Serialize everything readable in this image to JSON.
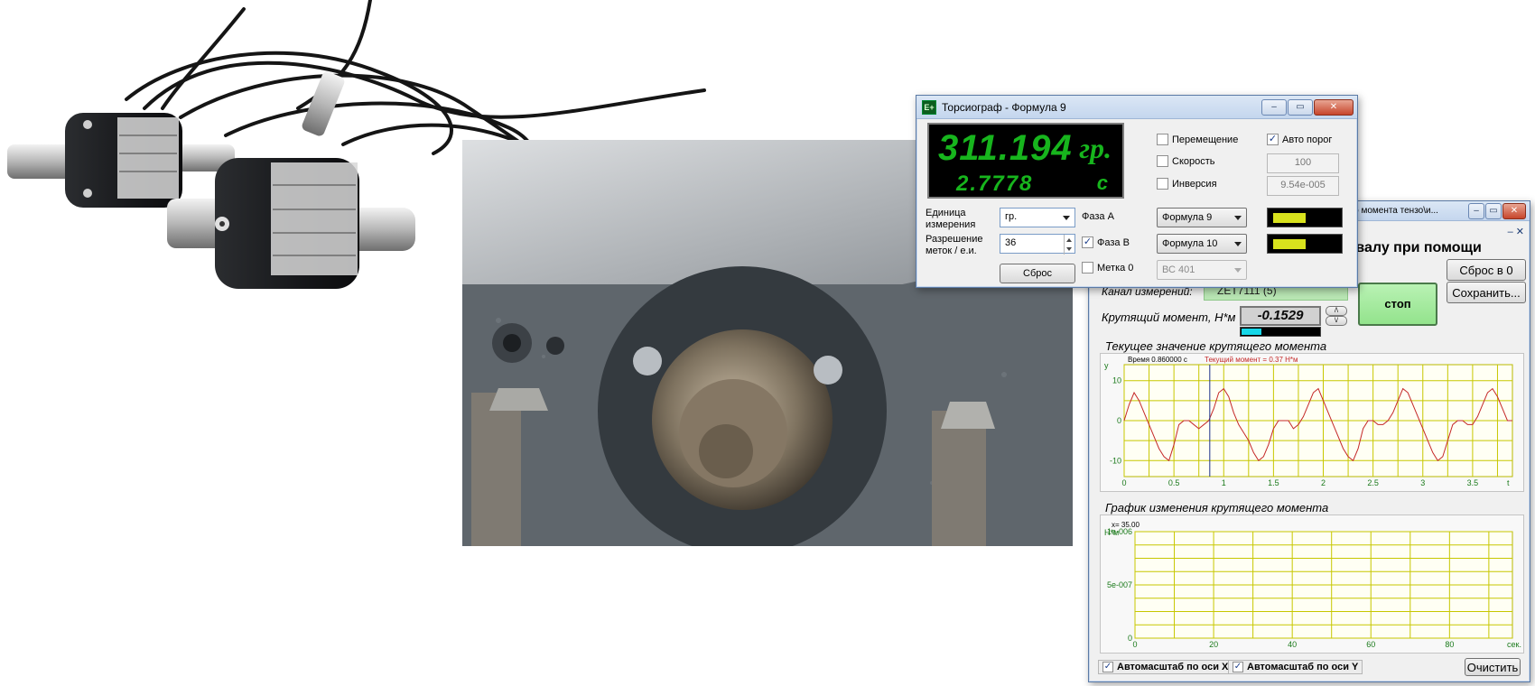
{
  "torsiograph": {
    "title": "Торсиограф - Формула 9",
    "icon_text": "E+",
    "display": {
      "primary_value": "311.194",
      "primary_unit": "гр.",
      "secondary_value": "2.7778",
      "secondary_unit": "с"
    },
    "unit_label": "Единица измерения",
    "unit_value": "гр.",
    "resolution_label": "Разрешение меток / е.и.",
    "resolution_value": "36",
    "reset_button": "Сброс",
    "phase_a_label": "Фаза А",
    "phase_b_label": "Фаза В",
    "mark0_label": "Метка 0",
    "phase_a_formula": "Формула 9",
    "phase_b_formula": "Формула 10",
    "mark0_source": "ВС 401",
    "displacement_label": "Перемещение",
    "speed_label": "Скорость",
    "inversion_label": "Инверсия",
    "auto_threshold_label": "Авто порог",
    "auto_threshold_value": "100",
    "inversion_value": "9.54e-005",
    "phase_a_level": 0.5,
    "phase_b_level": 0.5,
    "checks": {
      "phase_b": true,
      "mark0": false,
      "displacement": false,
      "speed": false,
      "inversion": false,
      "auto_threshold": true
    }
  },
  "torque": {
    "title_fragment": "щего момента тензо\\и...",
    "heading_fragment": "а валу при помощи",
    "channel_label": "Канал измерений:",
    "channel_value": "ZET7111 (5)",
    "torque_label": "Крутящий момент, Н*м",
    "torque_value": "-0.1529",
    "torque_level": 0.25,
    "stop_button": "стоп",
    "reset_zero_button": "Сброс в 0",
    "save_button": "Сохранить...",
    "up_symbol": "/\\",
    "down_symbol": "\\/",
    "current_panel_title": "Текущее значение крутящего момента",
    "history_panel_title": "График изменения крутящего момента",
    "autoscale_x": "Автомасштаб по оси X",
    "autoscale_y": "Автомасштаб по оси Y",
    "clear_button": "Очистить",
    "checks": {
      "autoscale_x": true,
      "autoscale_y": true
    }
  },
  "chart_data": [
    {
      "type": "line",
      "title": "Текущее значение крутящего момента",
      "ylabel": "y",
      "xlabel": "t",
      "xlim": [
        0,
        3.9
      ],
      "ylim": [
        -14,
        14
      ],
      "x_ticks": [
        "0",
        "0.5",
        "1",
        "1.5",
        "2",
        "2.5",
        "3",
        "3.5"
      ],
      "y_ticks": [
        "10",
        "0",
        "-10"
      ],
      "cursor_time_label": "Время 0.860000 с",
      "cursor_value_label": "Текущий момент = 0.37 Н*м",
      "cursor_x": 0.86,
      "grid": true,
      "series": [
        {
          "x": [
            0,
            0.05,
            0.1,
            0.15,
            0.2,
            0.25,
            0.3,
            0.35,
            0.4,
            0.45,
            0.5,
            0.55,
            0.6,
            0.65,
            0.7,
            0.75,
            0.8,
            0.85,
            0.9,
            0.95,
            1.0,
            1.05,
            1.1,
            1.15,
            1.2,
            1.25,
            1.3,
            1.35,
            1.4,
            1.45,
            1.5,
            1.55,
            1.6,
            1.65,
            1.7,
            1.75,
            1.8,
            1.85,
            1.9,
            1.95,
            2.0,
            2.05,
            2.1,
            2.15,
            2.2,
            2.25,
            2.3,
            2.35,
            2.4,
            2.45,
            2.5,
            2.55,
            2.6,
            2.65,
            2.7,
            2.75,
            2.8,
            2.85,
            2.9,
            2.95,
            3.0,
            3.05,
            3.1,
            3.15,
            3.2,
            3.25,
            3.3,
            3.35,
            3.4,
            3.45,
            3.5,
            3.55,
            3.6,
            3.65,
            3.7,
            3.75,
            3.8,
            3.85,
            3.9
          ],
          "values": [
            0,
            4,
            7,
            5,
            2,
            -1,
            -4,
            -7,
            -9,
            -10,
            -6,
            -1,
            0,
            0,
            -1,
            -2,
            -1,
            0,
            3,
            7,
            8,
            6,
            2,
            -1,
            -3,
            -5,
            -8,
            -10,
            -9,
            -6,
            -2,
            0,
            0,
            0,
            -2,
            -1,
            1,
            4,
            7,
            8,
            5,
            2,
            -1,
            -4,
            -7,
            -9,
            -10,
            -7,
            -2,
            0,
            0,
            -1,
            -1,
            0,
            2,
            5,
            8,
            7,
            4,
            1,
            -2,
            -5,
            -8,
            -10,
            -9,
            -5,
            -1,
            0,
            0,
            -1,
            -1,
            1,
            4,
            7,
            8,
            6,
            3,
            0,
            0
          ]
        }
      ]
    },
    {
      "type": "line",
      "title": "График изменения крутящего момента",
      "ylabel": "Н*м",
      "xlabel": "сек.",
      "cursor_label": "x=  35.00",
      "x_ticks": [
        "0",
        "20",
        "40",
        "60",
        "80"
      ],
      "y_ticks": [
        "1e-006",
        "5e-007",
        "0"
      ],
      "xlim": [
        0,
        96
      ],
      "ylim": [
        0,
        1e-06
      ],
      "grid": true,
      "series": []
    }
  ]
}
